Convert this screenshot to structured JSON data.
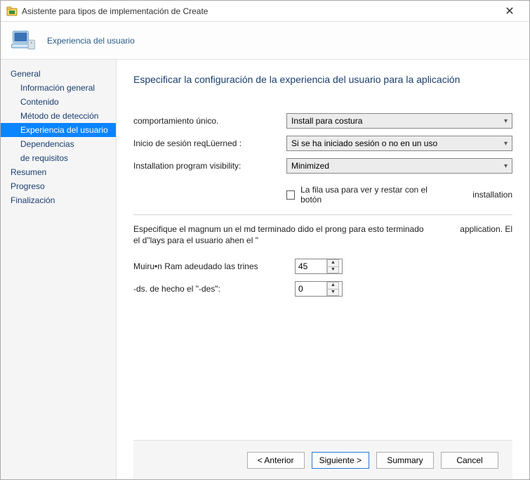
{
  "titlebar": {
    "title": "Asistente para tipos de implementación de Create"
  },
  "header": {
    "title": "Experiencia del usuario"
  },
  "nav": {
    "general": "General",
    "info_general": "Información general",
    "contenido": "Contenido",
    "metodo_deteccion": "Método de detección",
    "experiencia_usuario": "Experiencia del usuario",
    "dependencias": "Dependencias",
    "de_requisitos": "de requisitos",
    "resumen": "Resumen",
    "progreso": "Progreso",
    "finalizacion": "Finalización"
  },
  "page": {
    "heading": "Especificar la configuración de la experiencia del usuario para la aplicación"
  },
  "form": {
    "behavior_label": "comportamiento único.",
    "behavior_value": "Install para costura",
    "login_label": "Inicio de sesión reqLüerned :",
    "login_value": "Si se ha iniciado sesión o no en un uso",
    "visibility_label": "Installation program visibility:",
    "visibility_value": "Minimized",
    "checkbox_label": "La fila usa para ver y restar con el botón",
    "checkbox_right": "installation",
    "note_left": "Especifique el magnum un el md terminado dido el prong para esto terminado el d\"lays para el usuario ahen el \"",
    "note_right": "application. El",
    "ram_label": "Muiru•n Ram adeudado las trines",
    "ram_value": "45",
    "ds_label": "-ds. de hecho el \"-des\":",
    "ds_value": "0"
  },
  "footer": {
    "previous": "< Anterior",
    "next": "Siguiente >",
    "summary": "Summary",
    "cancel": "Cancel"
  }
}
